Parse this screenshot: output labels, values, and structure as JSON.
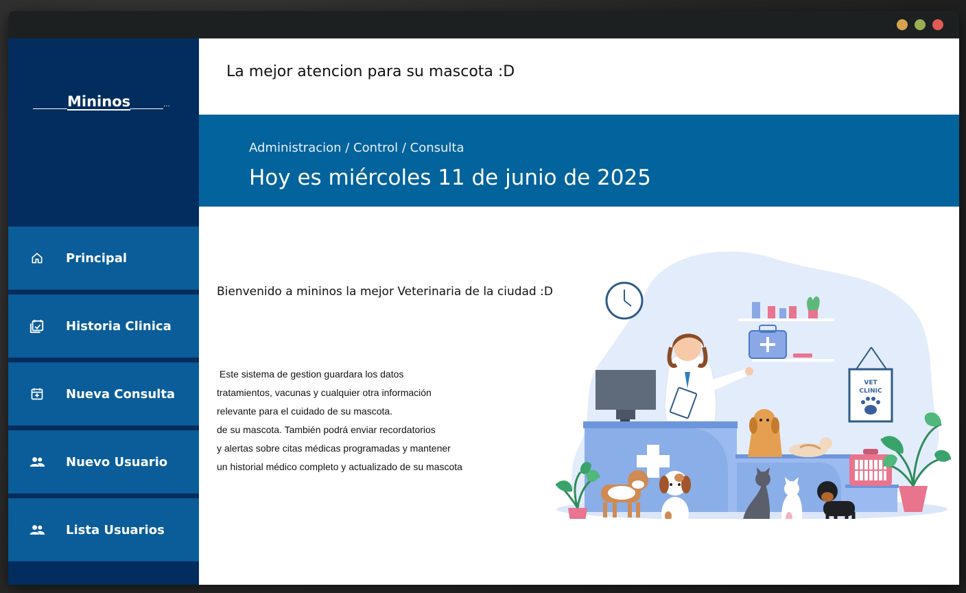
{
  "window": {
    "controls": {
      "minimize_color": "#d7a24f",
      "maximize_color": "#9aae52",
      "close_color": "#e35a55"
    }
  },
  "sidebar": {
    "logo_text": "Mininos",
    "logo_trailing": "...",
    "items": [
      {
        "label": "Principal",
        "icon": "home-icon"
      },
      {
        "label": "Historia Clinica",
        "icon": "calendar-check-icon"
      },
      {
        "label": "Nueva Consulta",
        "icon": "calendar-plus-icon"
      },
      {
        "label": "Nuevo Usuario",
        "icon": "users-icon"
      },
      {
        "label": "Lista Usuarios",
        "icon": "users-icon"
      }
    ]
  },
  "header": {
    "title": "La mejor atencion para su mascota :D"
  },
  "banner": {
    "breadcrumb": "Administracion / Control / Consulta",
    "date_text": "Hoy es miércoles 11 de junio de 2025"
  },
  "main": {
    "welcome": "Bienvenido a mininos la mejor Veterinaria de la ciudad :D",
    "description_lines": [
      " Este sistema de gestion guardara los datos",
      "tratamientos, vacunas y cualquier otra información",
      "relevante para el cuidado de su mascota.",
      "de su mascota. También podrá enviar recordatorios",
      "y alertas sobre citas médicas programadas y mantener",
      "un historial médico completo y actualizado de su mascota"
    ],
    "illustration": {
      "sign_line1": "VET",
      "sign_line2": "CLINIC"
    }
  },
  "colors": {
    "sidebar_bg": "#022d5e",
    "nav_item_bg": "#0a5d98",
    "banner_bg": "#03639c"
  }
}
